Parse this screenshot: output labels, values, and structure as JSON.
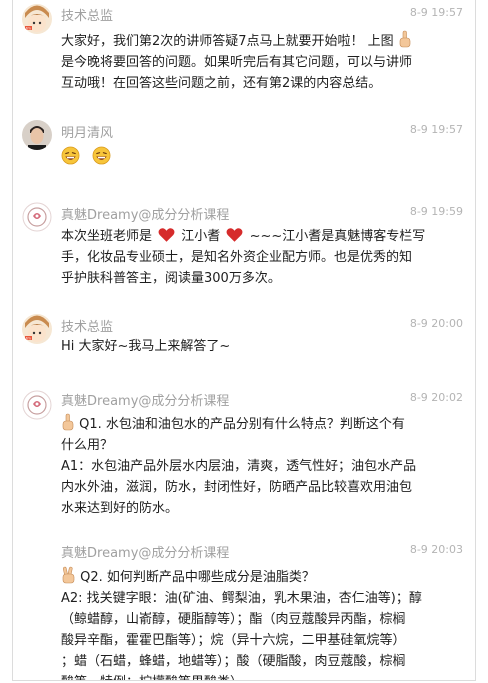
{
  "messages": [
    {
      "name": "技术总监",
      "time": "8-9 19:57",
      "line1": "大家好，我们第2次的讲师答疑7点马上就要开始啦！ 上图",
      "line2": "是今晚将要回答的问题。如果听完后有其它问题，可以与讲师",
      "line3": "互动哦！在回答这些问题之前，还有第2课的内容总结。"
    },
    {
      "name": "明月清风",
      "time": "8-9 19:57"
    },
    {
      "name": "真魅Dreamy@成分分析课程",
      "time": "8-9 19:59",
      "line1a": "本次坐班老师是",
      "line1b": "江小耆",
      "line1c": "~~~江小耆是真魅博客专栏写",
      "line2": "手，化妆品专业硕士，是知名外资企业配方师。也是优秀的知",
      "line3": "乎护肤科普答主，阅读量300万多次。"
    },
    {
      "name": "技术总监",
      "time": "8-9 20:00",
      "line1": "Hi 大家好~我马上来解答了~"
    },
    {
      "name": "真魅Dreamy@成分分析课程",
      "time": "8-9 20:02",
      "q1": "Q1. 水包油和油包水的产品分别有什么特点？判断这个有",
      "q2": "什么用？",
      "a1": "A1：水包油产品外层水内层油，清爽，透气性好；油包水产品",
      "a2": "内水外油，滋润，防水，封闭性好，防晒产品比较喜欢用油包",
      "a3": "水来达到好的防水。"
    },
    {
      "name": "真魅Dreamy@成分分析课程",
      "time": "8-9 20:03",
      "q1": "Q2. 如何判断产品中哪些成分是油脂类？",
      "a1": "A2: 找关键字眼：油(矿油、鳄梨油，乳木果油，杏仁油等)；醇",
      "a2": "（鲸蜡醇，山嵛醇，硬脂醇等）；酯（肉豆蔻酸异丙酯，棕榈",
      "a3": "酸异辛酯，霍霍巴酯等）；烷（异十六烷，二甲基硅氧烷等）",
      "a4": "；蜡（石蜡，蜂蜡，地蜡等）；酸（硬脂酸，肉豆蔻酸，棕榈",
      "a5": "酸等，特例：柠檬酸等果酸类）。"
    }
  ]
}
